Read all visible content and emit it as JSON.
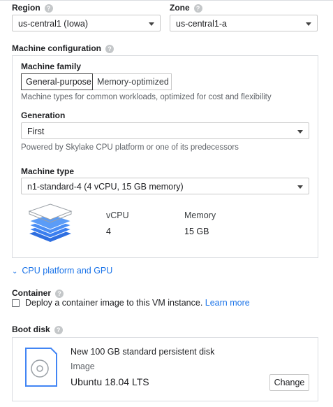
{
  "region": {
    "label": "Region",
    "value": "us-central1 (Iowa)"
  },
  "zone": {
    "label": "Zone",
    "value": "us-central1-a"
  },
  "machine_configuration": {
    "label": "Machine configuration",
    "machine_family": {
      "label": "Machine family",
      "tabs": [
        "General-purpose",
        "Memory-optimized"
      ],
      "active_tab": "General-purpose",
      "description": "Machine types for common workloads, optimized for cost and flexibility"
    },
    "generation": {
      "label": "Generation",
      "value": "First",
      "description": "Powered by Skylake CPU platform or one of its predecessors"
    },
    "machine_type": {
      "label": "Machine type",
      "value": "n1-standard-4 (4 vCPU, 15 GB memory)"
    },
    "summary": {
      "vcpu_label": "vCPU",
      "vcpu_value": "4",
      "memory_label": "Memory",
      "memory_value": "15 GB"
    }
  },
  "cpu_platform_link": "CPU platform and GPU",
  "container": {
    "label": "Container",
    "checkbox_label": "Deploy a container image to this VM instance.",
    "learn_more": "Learn more",
    "checked": false
  },
  "boot_disk": {
    "label": "Boot disk",
    "description": "New 100 GB standard persistent disk",
    "image_label": "Image",
    "image_value": "Ubuntu 18.04 LTS",
    "change_button": "Change"
  },
  "help_icon_glyph": "?",
  "colors": {
    "link": "#1a73e8",
    "icon_blue": "#4285f4",
    "border": "#dadce0",
    "muted": "#5f6368"
  }
}
